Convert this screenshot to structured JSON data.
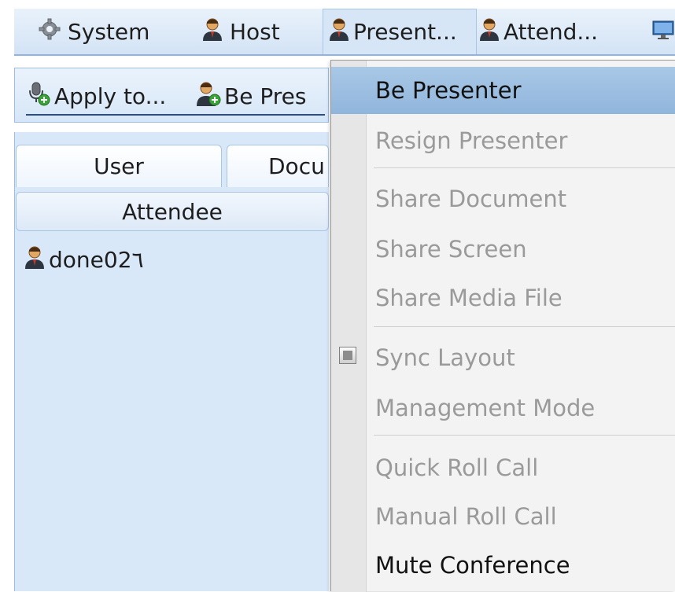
{
  "menubar": {
    "items": [
      {
        "label": "System",
        "icon": "gear-icon"
      },
      {
        "label": "Host",
        "icon": "user-icon"
      },
      {
        "label": "Present...",
        "icon": "user-icon"
      },
      {
        "label": "Attend...",
        "icon": "user-icon"
      },
      {
        "label": "",
        "icon": "monitor-icon"
      }
    ]
  },
  "toolbar": {
    "apply_label": "Apply to...",
    "be_presenter_label": "Be Pres"
  },
  "tabs": [
    "User",
    "Docu"
  ],
  "list": {
    "header": "Attendee",
    "rows": [
      {
        "name": "done02٦"
      }
    ]
  },
  "dropdown": {
    "items": [
      "Be Presenter",
      "Resign Presenter",
      "Share Document",
      "Share Screen",
      "Share Media File",
      "Sync Layout",
      "Management Mode",
      "Quick Roll Call",
      "Manual Roll Call",
      "Mute Conference"
    ]
  },
  "colors": {
    "menubar_bg": "#d3e3f5",
    "panel_bg": "#d8e8f9",
    "menu_highlight": "#a9c8e6",
    "disabled_text": "#9a9a9a"
  }
}
